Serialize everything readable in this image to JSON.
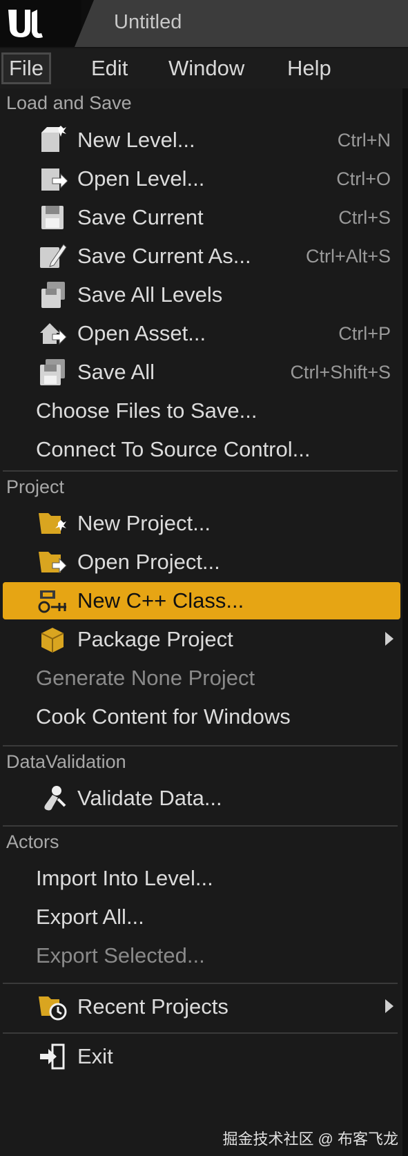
{
  "window": {
    "title": "Untitled"
  },
  "menubar": {
    "file": "File",
    "edit": "Edit",
    "window": "Window",
    "help": "Help"
  },
  "sections": {
    "load_and_save": "Load and Save",
    "project": "Project",
    "data_validation": "DataValidation",
    "actors": "Actors"
  },
  "items": {
    "new_level": {
      "label": "New Level...",
      "shortcut": "Ctrl+N"
    },
    "open_level": {
      "label": "Open Level...",
      "shortcut": "Ctrl+O"
    },
    "save_current": {
      "label": "Save Current",
      "shortcut": "Ctrl+S"
    },
    "save_current_as": {
      "label": "Save Current As...",
      "shortcut": "Ctrl+Alt+S"
    },
    "save_all_levels": {
      "label": "Save All Levels"
    },
    "open_asset": {
      "label": "Open Asset...",
      "shortcut": "Ctrl+P"
    },
    "save_all": {
      "label": "Save All",
      "shortcut": "Ctrl+Shift+S"
    },
    "choose_files": {
      "label": "Choose Files to Save..."
    },
    "connect_source": {
      "label": "Connect To Source Control..."
    },
    "new_project": {
      "label": "New Project..."
    },
    "open_project": {
      "label": "Open Project..."
    },
    "new_cpp_class": {
      "label": "New C++ Class..."
    },
    "package_project": {
      "label": "Package Project"
    },
    "generate_project": {
      "label": "Generate None Project"
    },
    "cook_content": {
      "label": "Cook Content for Windows"
    },
    "validate_data": {
      "label": "Validate Data..."
    },
    "import_into_level": {
      "label": "Import Into Level..."
    },
    "export_all": {
      "label": "Export All..."
    },
    "export_selected": {
      "label": "Export Selected..."
    },
    "recent_projects": {
      "label": "Recent Projects"
    },
    "exit": {
      "label": "Exit"
    }
  },
  "colors": {
    "highlight": "#e6a514",
    "background": "#1a1a1a"
  },
  "watermark": "掘金技术社区 @ 布客飞龙"
}
